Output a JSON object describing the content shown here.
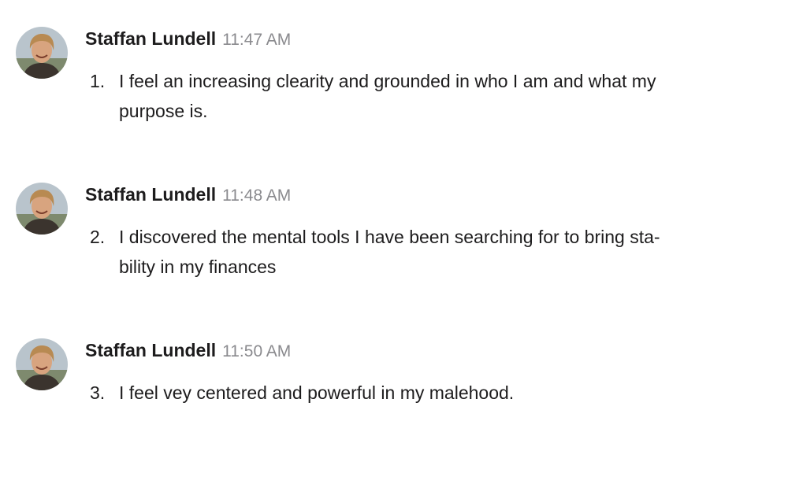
{
  "messages": [
    {
      "sender": "Staffan Lundell",
      "time": "11:47 AM",
      "number": "1.",
      "text_lines": [
        "I feel an increasing clearity and grounded in who I am and what my",
        "purpose is."
      ]
    },
    {
      "sender": "Staffan Lundell",
      "time": "11:48 AM",
      "number": "2.",
      "text_lines": [
        "I discovered the mental tools I have been searching for to bring sta-",
        "bility in my finances"
      ]
    },
    {
      "sender": "Staffan Lundell",
      "time": "11:50 AM",
      "number": "3.",
      "text_lines": [
        "I feel vey centered and powerful in my malehood."
      ]
    }
  ],
  "avatar_icon": "user-photo-avatar"
}
